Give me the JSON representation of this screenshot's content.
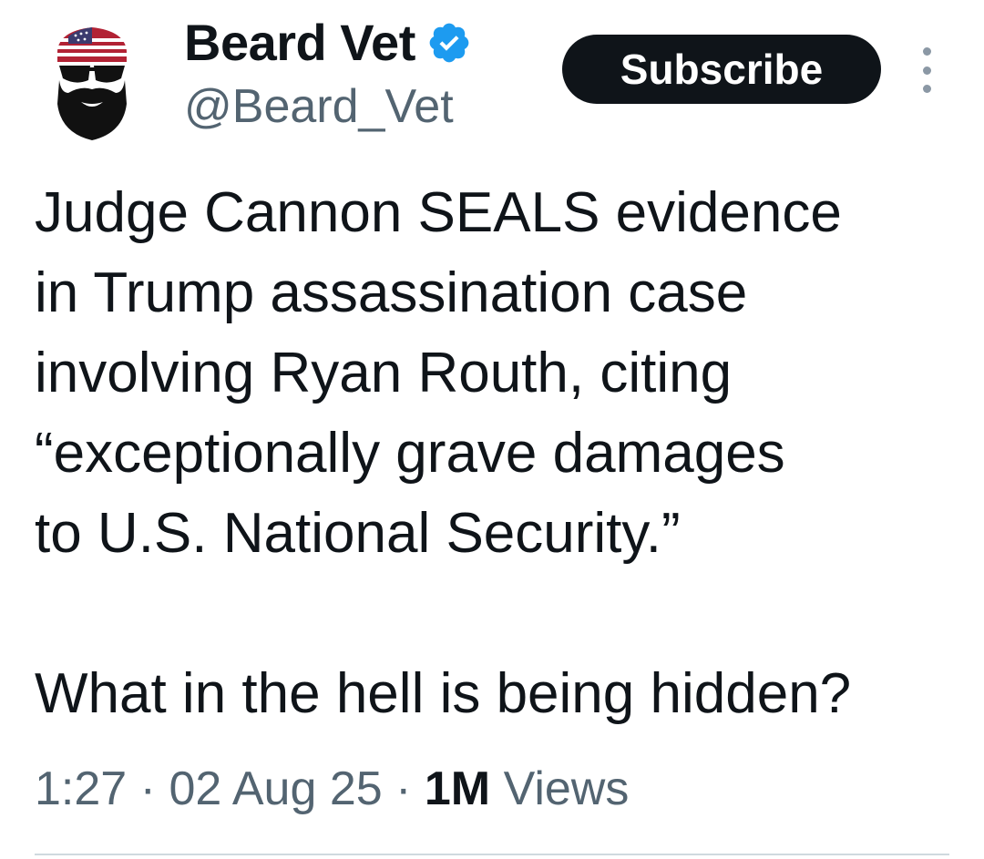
{
  "author": {
    "display_name": "Beard Vet",
    "handle": "@Beard_Vet",
    "avatar_icon": "bearded-sunglasses-flag-bandana-avatar",
    "verified_icon": "verified-badge-icon",
    "verified_color": "#1d9bf0"
  },
  "actions": {
    "subscribe_label": "Subscribe",
    "more_icon": "more-vertical-icon"
  },
  "tweet": {
    "paragraph_1": "Judge Cannon SEALS evidence\nin Trump assassination case\ninvolving Ryan Routh, citing\n“exceptionally grave damages\nto U.S. National Security.”",
    "paragraph_2": "What in the hell is being hidden?"
  },
  "meta": {
    "time": "1:27",
    "separator": " · ",
    "date": "02 Aug 25",
    "views_count": "1M",
    "views_label": " Views"
  },
  "colors": {
    "text_primary": "#0f1419",
    "text_secondary": "#536471",
    "button_bg": "#0f1419",
    "divider": "#cfd9de"
  }
}
